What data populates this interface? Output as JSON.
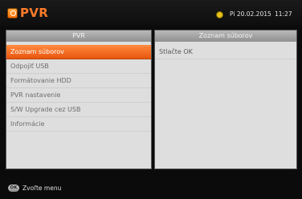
{
  "header": {
    "title": "PVR",
    "icon": "pvr-icon",
    "clock_icon": "clock-icon",
    "date": "Pi 20.02.2015",
    "time": "11:27"
  },
  "left_panel": {
    "title": "PVR",
    "items": [
      {
        "label": "Zoznam súborov",
        "selected": true
      },
      {
        "label": "Odpojiť USB",
        "selected": false
      },
      {
        "label": "Formátovanie HDD",
        "selected": false
      },
      {
        "label": "PVR nastavenie",
        "selected": false
      },
      {
        "label": "S/W Upgrade cez USB",
        "selected": false
      },
      {
        "label": "Informácie",
        "selected": false
      }
    ]
  },
  "right_panel": {
    "title": "Zoznam súborov",
    "message": "Stlačte OK"
  },
  "footer": {
    "key_label": "OK",
    "hint": "Zvoľte menu"
  },
  "colors": {
    "accent": "#ff7b2a",
    "selected": "#f06a1d",
    "panel_bg": "#dedede",
    "panel_header": "#a3a3a3"
  }
}
